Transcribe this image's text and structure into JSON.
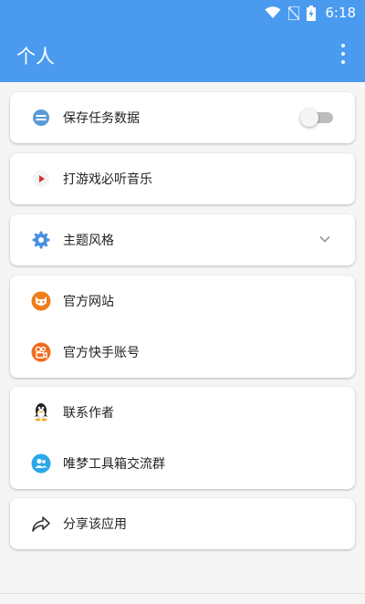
{
  "status": {
    "time": "6:18"
  },
  "appbar": {
    "title": "个人"
  },
  "items": {
    "save_task": {
      "label": "保存任务数据",
      "toggle_on": false
    },
    "music": {
      "label": "打游戏必听音乐"
    },
    "theme": {
      "label": "主题风格"
    },
    "website": {
      "label": "官方网站"
    },
    "kuaishou": {
      "label": "官方快手账号"
    },
    "contact": {
      "label": "联系作者"
    },
    "group": {
      "label": "唯梦工具箱交流群"
    },
    "share": {
      "label": "分享该应用"
    }
  },
  "colors": {
    "primary": "#4a9bf0",
    "toggle_off": "#bdbdbd"
  }
}
